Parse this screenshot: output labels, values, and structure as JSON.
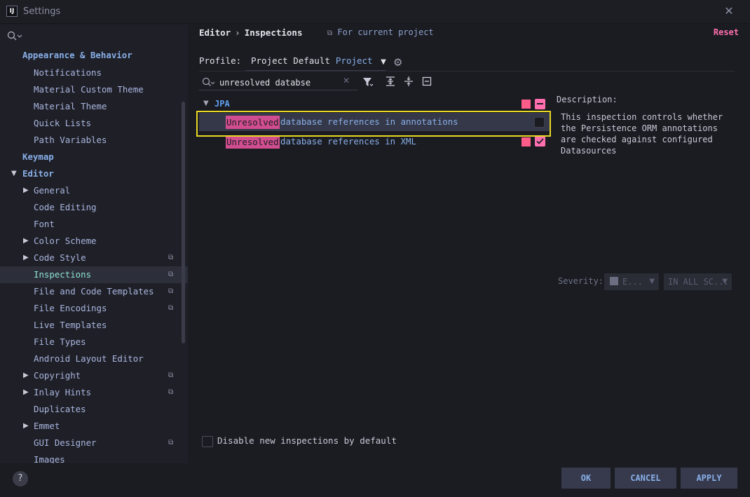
{
  "window": {
    "logo_text": "IJ",
    "title": "Settings",
    "close": "✕"
  },
  "sidebar": {
    "search_placeholder": "",
    "items": [
      {
        "label": "Appearance & Behavior",
        "kind": "section"
      },
      {
        "label": "Notifications"
      },
      {
        "label": "Material Custom Theme"
      },
      {
        "label": "Material Theme"
      },
      {
        "label": "Quick Lists"
      },
      {
        "label": "Path Variables"
      },
      {
        "label": "Keymap",
        "kind": "section"
      },
      {
        "label": "Editor",
        "kind": "section",
        "expanded": true
      },
      {
        "label": "General",
        "collapsed": true
      },
      {
        "label": "Code Editing"
      },
      {
        "label": "Font"
      },
      {
        "label": "Color Scheme",
        "collapsed": true
      },
      {
        "label": "Code Style",
        "collapsed": true,
        "project_scoped": true
      },
      {
        "label": "Inspections",
        "selected": true,
        "project_scoped": true
      },
      {
        "label": "File and Code Templates",
        "project_scoped": true
      },
      {
        "label": "File Encodings",
        "project_scoped": true
      },
      {
        "label": "Live Templates"
      },
      {
        "label": "File Types"
      },
      {
        "label": "Android Layout Editor"
      },
      {
        "label": "Copyright",
        "collapsed": true,
        "project_scoped": true
      },
      {
        "label": "Inlay Hints",
        "collapsed": true,
        "project_scoped": true
      },
      {
        "label": "Duplicates"
      },
      {
        "label": "Emmet",
        "collapsed": true
      },
      {
        "label": "GUI Designer",
        "project_scoped": true
      },
      {
        "label": "Images"
      }
    ]
  },
  "header": {
    "breadcrumb_parent": "Editor",
    "breadcrumb_sep": "›",
    "breadcrumb_current": "Inspections",
    "scope_label": "For current project",
    "reset_label": "Reset"
  },
  "profile": {
    "label": "Profile:",
    "value": "Project Default",
    "scope": "Project"
  },
  "filter": {
    "value": "unresolved databse",
    "placeholder": ""
  },
  "inspections": {
    "group": "JPA",
    "rows": [
      {
        "match": "Unresolved",
        "rest": "database references in annotations",
        "selected": true,
        "enabled": false
      },
      {
        "match": "Unresolved",
        "rest": "database references in XML",
        "selected": false,
        "enabled": true
      }
    ]
  },
  "description": {
    "title": "Description:",
    "line1": "This inspection controls whether",
    "line2": "the Persistence ORM annotations",
    "line3": "are checked against configured",
    "line4": "Datasources"
  },
  "severity": {
    "label": "Severity:",
    "level": "E...",
    "scope": "IN ALL SC..."
  },
  "options": {
    "disable_new": "Disable new inspections by default"
  },
  "buttons": {
    "help": "?",
    "ok": "OK",
    "cancel": "CANCEL",
    "apply": "APPLY"
  },
  "colors": {
    "accent": "#ff6fb0",
    "highlight": "#d04d8f",
    "severity_error": "#ff5c8a",
    "focus_frame": "#e8d724",
    "link": "#88aee8"
  }
}
